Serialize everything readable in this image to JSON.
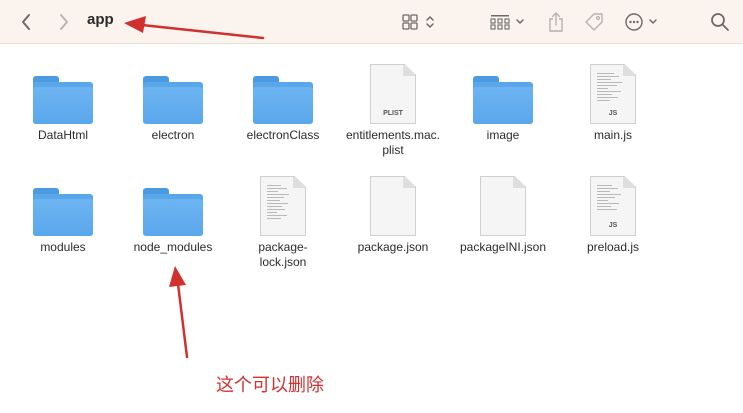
{
  "toolbar": {
    "title": "app",
    "icons": {
      "back": "chevron-left-icon",
      "forward": "chevron-right-icon",
      "view": "icon-grid-view-icon",
      "group": "group-view-icon",
      "share": "share-icon",
      "tag": "tag-icon",
      "more": "ellipsis-circle-icon",
      "search": "search-icon"
    }
  },
  "items": [
    {
      "name": "DataHtml",
      "kind": "folder"
    },
    {
      "name": "electron",
      "kind": "folder"
    },
    {
      "name": "electronClass",
      "kind": "folder"
    },
    {
      "name": "entitlements.mac.plist",
      "kind": "plist",
      "badge": "PLIST",
      "label_lines": [
        "entitlements.mac.",
        "plist"
      ]
    },
    {
      "name": "image",
      "kind": "folder"
    },
    {
      "name": "main.js",
      "kind": "js",
      "badge": "JS"
    },
    {
      "name": "modules",
      "kind": "folder"
    },
    {
      "name": "node_modules",
      "kind": "folder"
    },
    {
      "name": "package-lock.json",
      "kind": "text",
      "label_lines": [
        "package-",
        "lock.json"
      ]
    },
    {
      "name": "package.json",
      "kind": "blank"
    },
    {
      "name": "packageINI.json",
      "kind": "blank"
    },
    {
      "name": "preload.js",
      "kind": "js",
      "badge": "JS"
    }
  ],
  "annotation": {
    "text": "这个可以删除",
    "color": "#d22f2f"
  }
}
